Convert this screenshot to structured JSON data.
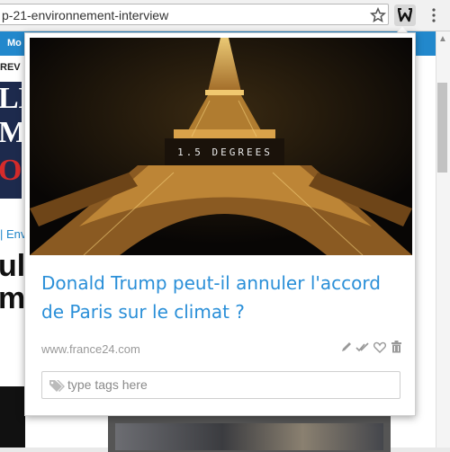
{
  "browser": {
    "url": "p-21-environnement-interview",
    "star_icon": "bookmark-star-icon",
    "extension_icon": "wallabag-w-icon",
    "menu_icon": "kebab-menu-icon"
  },
  "background_page": {
    "nav_label": "Mo",
    "sub_label": "REV",
    "banner_lines": [
      "LE",
      "MI",
      "OI"
    ],
    "crumb": "| Env",
    "headline_lines": [
      "ul",
      "m"
    ]
  },
  "popup": {
    "image_caption": "1.5 DEGREES",
    "title": "Donald Trump peut-il annuler l'accord de Paris sur le climat ?",
    "domain": "www.france24.com",
    "actions": [
      "edit-icon",
      "mark-read-check-icon",
      "favorite-heart-icon",
      "delete-trash-icon"
    ],
    "tags_placeholder": "type tags here",
    "colors": {
      "title": "#2a8fd8",
      "accent": "#2288cc"
    }
  }
}
